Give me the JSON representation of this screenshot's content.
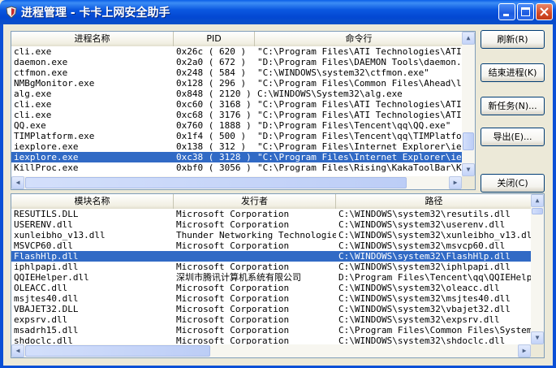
{
  "window": {
    "title": "进程管理 - 卡卡上网安全助手",
    "icon": "shield-icon"
  },
  "process_list": {
    "columns": [
      "进程名称",
      "PID",
      "命令行"
    ],
    "rows": [
      [
        "cli.exe",
        "0x26c ( 620 )",
        "\"C:\\Program Files\\ATI Technologies\\ATI.ACE"
      ],
      [
        "daemon.exe",
        "0x2a0 ( 672 )",
        "\"D:\\Program Files\\DAEMON Tools\\daemon.exe\""
      ],
      [
        "ctfmon.exe",
        "0x248 ( 584 )",
        "\"C:\\WINDOWS\\system32\\ctfmon.exe\""
      ],
      [
        "NMBgMonitor.exe",
        "0x128 ( 296 )",
        "\"C:\\Program Files\\Common Files\\Ahead\\lib\\N"
      ],
      [
        "alg.exe",
        "0x848 ( 2120 )",
        "C:\\WINDOWS\\System32\\alg.exe"
      ],
      [
        "cli.exe",
        "0xc60 ( 3168 )",
        "\"C:\\Program Files\\ATI Technologies\\ATI.ACE"
      ],
      [
        "cli.exe",
        "0xc68 ( 3176 )",
        "\"C:\\Program Files\\ATI Technologies\\ATI.ACE"
      ],
      [
        "QQ.exe",
        "0x760 ( 1888 )",
        "\"D:\\Program Files\\Tencent\\qq\\QQ.exe\""
      ],
      [
        "TIMPlatform.exe",
        "0x1f4 ( 500 )",
        "\"D:\\Program Files\\Tencent\\qq\\TIMPlatform.e"
      ],
      [
        "iexplore.exe",
        "0x138 ( 312 )",
        "\"C:\\Program Files\\Internet Explorer\\iexplo"
      ],
      [
        "iexplore.exe",
        "0xc38 ( 3128 )",
        "\"C:\\Program Files\\Internet Explorer\\iexplo"
      ],
      [
        "KillProc.exe",
        "0xbf0 ( 3056 )",
        "\"C:\\Program Files\\Rising\\KakaToolBar\\KillP"
      ]
    ],
    "selected_row": 10
  },
  "module_list": {
    "columns": [
      "模块名称",
      "发行者",
      "路径"
    ],
    "rows": [
      [
        "RESUTILS.DLL",
        "Microsoft Corporation",
        "C:\\WINDOWS\\system32\\resutils.dll"
      ],
      [
        "USERENV.dll",
        "Microsoft Corporation",
        "C:\\WINDOWS\\system32\\userenv.dll"
      ],
      [
        "xunleibho_v13.dll",
        "Thunder Networking Technologies,I",
        "C:\\WINDOWS\\system32\\xunleibho_v13.dll"
      ],
      [
        "MSVCP60.dll",
        "Microsoft Corporation",
        "C:\\WINDOWS\\system32\\msvcp60.dll"
      ],
      [
        "FlashHlp.dll",
        "",
        "C:\\WINDOWS\\system32\\FlashHlp.dll"
      ],
      [
        "iphlpapi.dll",
        "Microsoft Corporation",
        "C:\\WINDOWS\\system32\\iphlpapi.dll"
      ],
      [
        "QQIEHelper.dll",
        "深圳市腾讯计算机系统有限公司",
        "D:\\Program Files\\Tencent\\qq\\QQIEHelper.d"
      ],
      [
        "OLEACC.dll",
        "Microsoft Corporation",
        "C:\\WINDOWS\\system32\\oleacc.dll"
      ],
      [
        "msjtes40.dll",
        "Microsoft Corporation",
        "C:\\WINDOWS\\system32\\msjtes40.dll"
      ],
      [
        "VBAJET32.DLL",
        "Microsoft Corporation",
        "C:\\WINDOWS\\system32\\vbajet32.dll"
      ],
      [
        "expsrv.dll",
        "Microsoft Corporation",
        "C:\\WINDOWS\\system32\\expsrv.dll"
      ],
      [
        "msadrh15.dll",
        "Microsoft Corporation",
        "C:\\Program Files\\Common Files\\System\\ado"
      ],
      [
        "shdoclc.dll",
        "Microsoft Corporation",
        "C:\\WINDOWS\\system32\\shdoclc.dll"
      ]
    ],
    "selected_row": 4
  },
  "buttons": {
    "refresh": "刷新(R)",
    "end_process": "结束进程(K)",
    "new_task": "新任务(N)...",
    "export": "导出(E)...",
    "close": "关闭(C)"
  },
  "colors": {
    "selection": "#316AC5",
    "titlebar": "#0A4FD6"
  }
}
